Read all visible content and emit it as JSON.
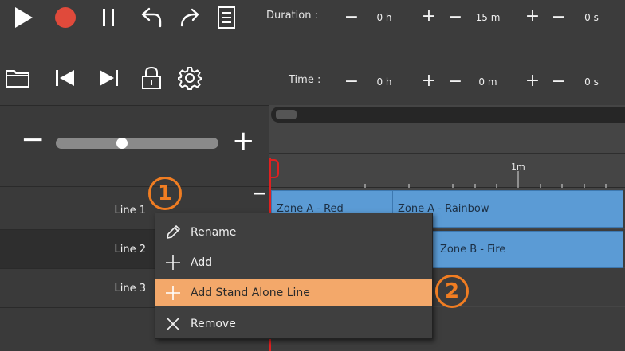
{
  "toolbar": {
    "row1_icons": [
      "play-icon",
      "record-icon",
      "pause-icon",
      "undo-icon",
      "redo-icon",
      "document-icon"
    ],
    "row2_icons": [
      "folder-icon",
      "skip-back-icon",
      "skip-forward-icon",
      "lock-icon",
      "gear-icon"
    ]
  },
  "duration": {
    "label": "Duration :",
    "hours": "0 h",
    "minutes": "15 m",
    "seconds": "0 s",
    "minus": "−",
    "plus": "+"
  },
  "time": {
    "label": "Time :",
    "hours": "0 h",
    "minutes": "0 m",
    "seconds": "0 s",
    "minus": "−",
    "plus": "+"
  },
  "zoom": {
    "minus": "−",
    "plus": "+",
    "level": 0.35
  },
  "timeline": {
    "ruler_label": "1m",
    "collapse": "−"
  },
  "lines": [
    {
      "label": "Line 1"
    },
    {
      "label": "Line 2"
    },
    {
      "label": "Line 3"
    }
  ],
  "clips": [
    {
      "label": "Zone A - Red"
    },
    {
      "label": "Zone A - Rainbow"
    },
    {
      "label": "Zone B - Fire"
    }
  ],
  "context_menu": {
    "items": [
      {
        "label": "Rename",
        "icon": "pencil-icon"
      },
      {
        "label": "Add",
        "icon": "plus-icon"
      },
      {
        "label": "Add Stand Alone Line",
        "icon": "plus-icon"
      },
      {
        "label": "Remove",
        "icon": "x-icon"
      }
    ]
  },
  "callouts": [
    "1",
    "2"
  ],
  "colors": {
    "accent_orange": "#f07d22",
    "highlight": "#f3a86a",
    "clip_blue": "#5b9bd5",
    "record_red": "#e04a3b",
    "playhead_red": "#e02020"
  }
}
